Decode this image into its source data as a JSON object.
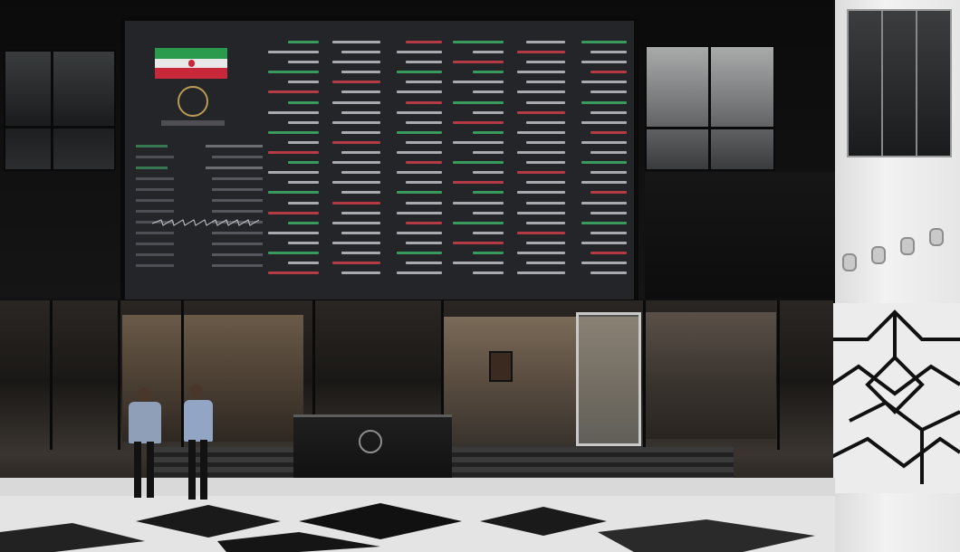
{
  "scene": {
    "colors": {
      "board_background": "#242528",
      "ticker_green": "#3fb86a",
      "ticker_red": "#d8404c",
      "ticker_white": "#c9ccd1",
      "flag_green": "#2a9a4c",
      "flag_red": "#c8283a",
      "wall": "#f2f2f2"
    },
    "elements": {
      "board": "stock-ticker-board",
      "flag": "iran-flag",
      "desk": "reception-desk",
      "people": [
        "person-left",
        "person-right"
      ]
    }
  }
}
